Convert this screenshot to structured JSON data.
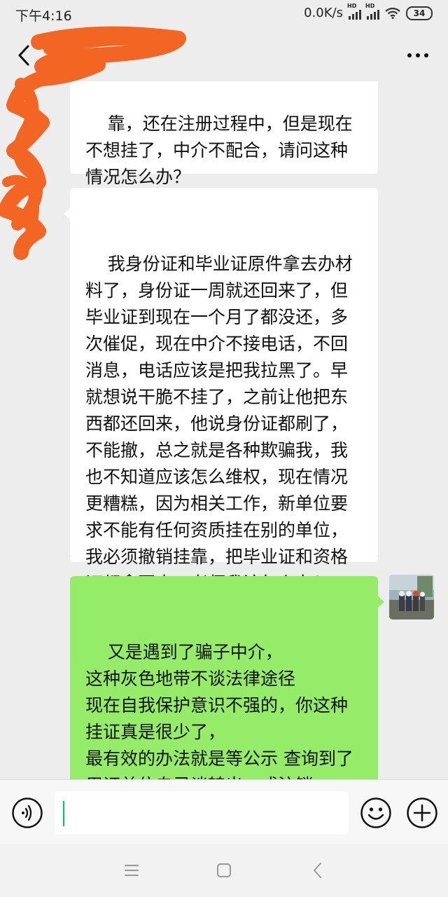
{
  "status_bar": {
    "time": "下午4:16",
    "network_speed": "0.0K/s",
    "signal_label_1": "HD",
    "signal_label_2": "HD",
    "battery": "34"
  },
  "header": {
    "contact_name": "",
    "back_icon": "chevron-left-icon",
    "more_icon": "more-dots-icon"
  },
  "messages": [
    {
      "side": "left",
      "text": "靠，还在注册过程中，但是现在不想挂了，中介不配合，请问这种情况怎么办？"
    },
    {
      "side": "left",
      "text": "我身份证和毕业证原件拿去办材料了，身份证一周就还回来了，但毕业证到现在一个月了都没还，多次催促，现在中介不接电话，不回消息，电话应该是把我拉黑了。早就想说干脆不挂了，之前让他把东西都还回来，他说身份证都刷了，不能撤，总之就是各种欺骗我，我也不知道应该怎么维权，现在情况更糟糕，因为相关工作，新单位要求不能有任何资质挂在别的单位，我必须撤销挂靠，把毕业证和资格证都拿回来，老师我该怎么办？"
    },
    {
      "side": "right",
      "text": "又是遇到了骗子中介，\n这种灰色地带不谈法律途径\n现在自我保护意识不强的，你这种挂证真是很少了，\n最有效的办法就是等公示 查询到了用证单位自己谈转出，或注销。\n最次就是劳动仲裁了。"
    }
  ],
  "input_bar": {
    "voice_icon": "voice-icon",
    "input_value": "",
    "emoji_icon": "emoji-icon",
    "plus_icon": "plus-icon"
  },
  "colors": {
    "background": "#ededed",
    "bubble_left": "#ffffff",
    "bubble_right": "#95ec69",
    "scribble": "#f26522",
    "caret": "#07c160"
  }
}
